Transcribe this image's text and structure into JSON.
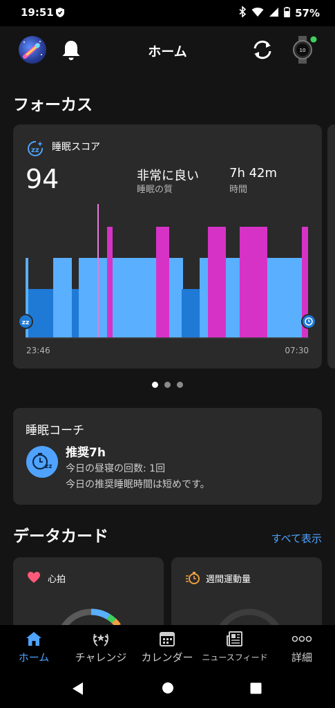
{
  "status_bar": {
    "time": "19:51",
    "battery": "57%"
  },
  "header": {
    "title": "ホーム"
  },
  "focus": {
    "section_title": "フォーカス",
    "card": {
      "label": "睡眠スコア",
      "score": "94",
      "quality_value": "非常に良い",
      "quality_label": "睡眠の質",
      "duration_value": "7h 42m",
      "duration_label": "時間",
      "start_time": "23:46",
      "end_time": "07:30"
    },
    "page_dots": 3,
    "active_dot": 0
  },
  "coach": {
    "title": "睡眠コーチ",
    "headline": "推奨7h",
    "line1": "今日の昼寝の回数: 1回",
    "line2": "今日の推奨睡眠時間は短めです。"
  },
  "data_cards": {
    "section_title": "データカード",
    "show_all": "すべて表示",
    "cards": [
      {
        "label": "心拍",
        "icon": "heart-icon"
      },
      {
        "label": "週間運動量",
        "icon": "stopwatch-flame-icon"
      }
    ]
  },
  "bottom_nav": {
    "items": [
      {
        "label": "ホーム",
        "icon": "home-icon",
        "active": true
      },
      {
        "label": "チャレンジ",
        "icon": "laurel-icon",
        "active": false
      },
      {
        "label": "カレンダー",
        "icon": "calendar-icon",
        "active": false
      },
      {
        "label": "ニュースフィード",
        "icon": "newsfeed-icon",
        "active": false
      },
      {
        "label": "詳細",
        "icon": "more-icon",
        "active": false
      }
    ]
  },
  "colors": {
    "accent": "#4fa3ff",
    "rem": "#d633c6",
    "light_sleep": "#5aafff",
    "deep_sleep": "#1f7ad6",
    "awake": "#e879e0",
    "card_bg": "#2a2a2a"
  }
}
